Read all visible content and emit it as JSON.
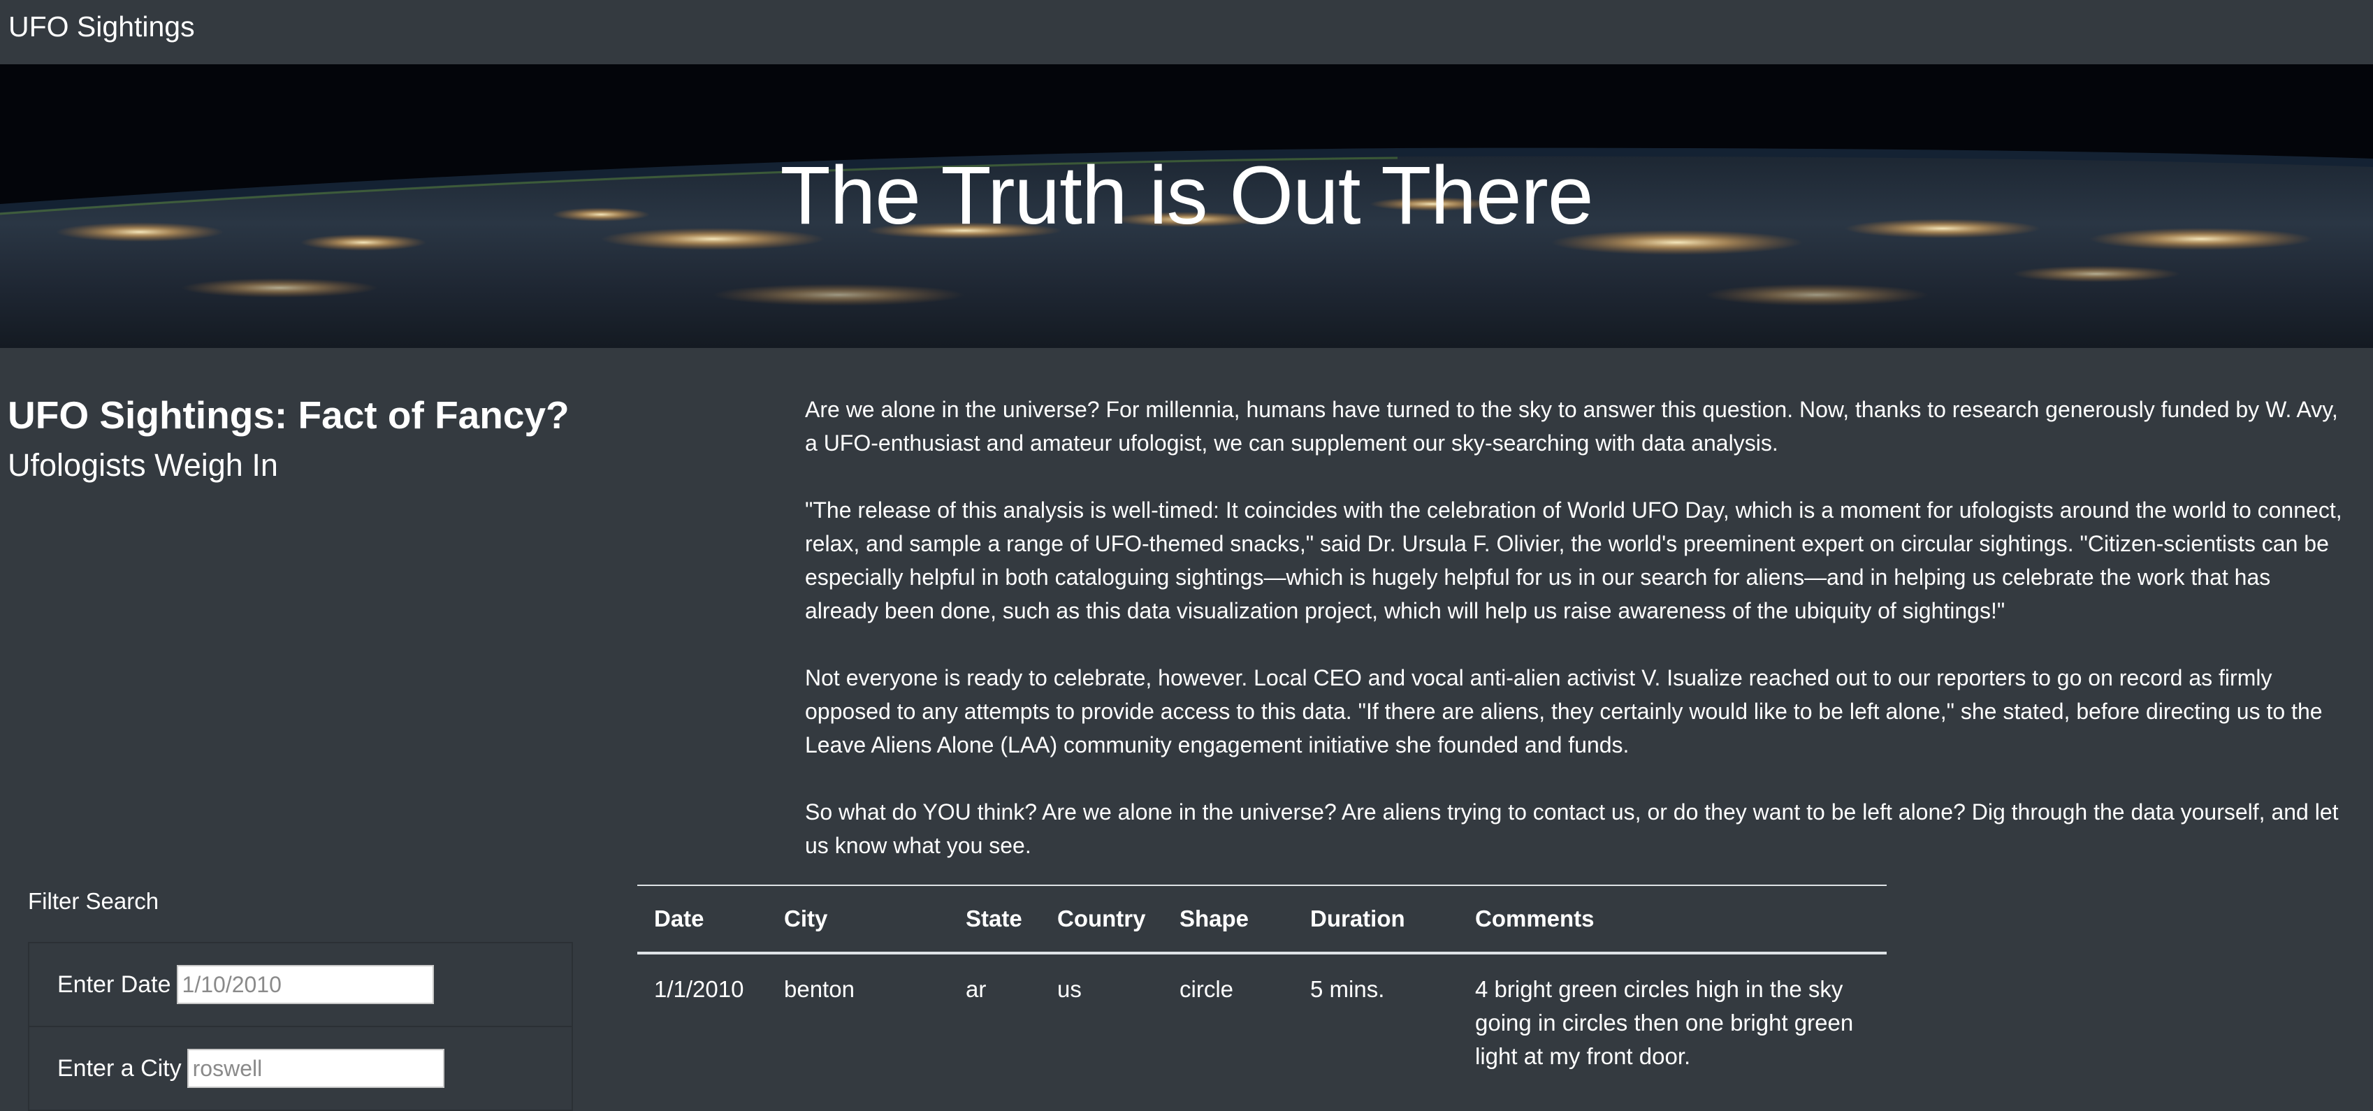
{
  "navbar": {
    "brand": "UFO Sightings"
  },
  "hero": {
    "title": "The Truth is Out There"
  },
  "article": {
    "title": "UFO Sightings: Fact of Fancy?",
    "subtitle": "Ufologists Weigh In",
    "paragraphs": [
      "Are we alone in the universe? For millennia, humans have turned to the sky to answer this question. Now, thanks to research generously funded by W. Avy, a UFO-enthusiast and amateur ufologist, we can supplement our sky-searching with data analysis.",
      "\"The release of this analysis is well-timed: It coincides with the celebration of World UFO Day, which is a moment for ufologists around the world to connect, relax, and sample a range of UFO-themed snacks,\" said Dr. Ursula F. Olivier, the world's preeminent expert on circular sightings. \"Citizen-scientists can be especially helpful in both cataloguing sightings—which is hugely helpful for us in our search for aliens—and in helping us celebrate the work that has already been done, such as this data visualization project, which will help us raise awareness of the ubiquity of sightings!\"",
      "Not everyone is ready to celebrate, however. Local CEO and vocal anti-alien activist V. Isualize reached out to our reporters to go on record as firmly opposed to any attempts to provide access to this data. \"If there are aliens, they certainly would like to be left alone,\" she stated, before directing us to the Leave Aliens Alone (LAA) community engagement initiative she founded and funds.",
      "So what do YOU think? Are we alone in the universe? Are aliens trying to contact us, or do they want to be left alone? Dig through the data yourself, and let us know what you see."
    ]
  },
  "filters": {
    "heading": "Filter Search",
    "date": {
      "label": "Enter Date",
      "placeholder": "1/10/2010"
    },
    "city": {
      "label": "Enter a City",
      "placeholder": "roswell"
    }
  },
  "table": {
    "headers": [
      "Date",
      "City",
      "State",
      "Country",
      "Shape",
      "Duration",
      "Comments"
    ],
    "rows": [
      [
        "1/1/2010",
        "benton",
        "ar",
        "us",
        "circle",
        "5 mins.",
        "4 bright green circles high in the sky going in circles then one bright green light at my front door."
      ]
    ]
  }
}
